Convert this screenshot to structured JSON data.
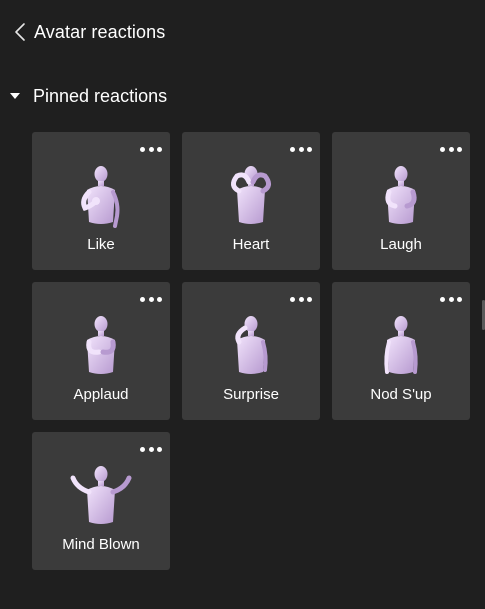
{
  "header": {
    "title": "Avatar reactions"
  },
  "section": {
    "title": "Pinned reactions"
  },
  "reactions": [
    {
      "label": "Like",
      "pose": "like"
    },
    {
      "label": "Heart",
      "pose": "heart"
    },
    {
      "label": "Laugh",
      "pose": "laugh"
    },
    {
      "label": "Applaud",
      "pose": "applaud"
    },
    {
      "label": "Surprise",
      "pose": "surprise"
    },
    {
      "label": "Nod S'up",
      "pose": "nod"
    },
    {
      "label": "Mind Blown",
      "pose": "mindblown"
    }
  ],
  "colors": {
    "background": "#1f1f1f",
    "tile": "#3b3b3b",
    "text": "#ffffff",
    "avatar_light": "#f1e3fb",
    "avatar_shade": "#b79ad0"
  }
}
